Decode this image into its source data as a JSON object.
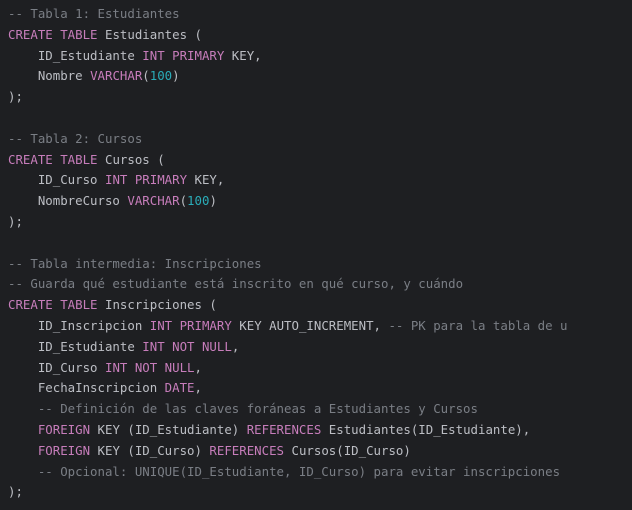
{
  "colors": {
    "background": "#1e1f22",
    "default": "#bcbec4",
    "comment": "#7a7e85",
    "keyword": "#cf8e6d",
    "type": "#c77dbb",
    "number": "#2aacb8",
    "punctuation": "#bcbec4"
  },
  "lines": [
    {
      "tokens": [
        {
          "text": "-- Tabla 1: Estudiantes",
          "kind": "comment"
        }
      ]
    },
    {
      "tokens": [
        {
          "text": "CREATE TABLE",
          "kind": "type"
        },
        {
          "text": " Estudiantes (",
          "kind": "default"
        }
      ]
    },
    {
      "tokens": [
        {
          "text": "    ID_Estudiante ",
          "kind": "default"
        },
        {
          "text": "INT PRIMARY",
          "kind": "type"
        },
        {
          "text": " KEY,",
          "kind": "default"
        }
      ]
    },
    {
      "tokens": [
        {
          "text": "    Nombre ",
          "kind": "default"
        },
        {
          "text": "VARCHAR",
          "kind": "type"
        },
        {
          "text": "(",
          "kind": "default"
        },
        {
          "text": "100",
          "kind": "number"
        },
        {
          "text": ")",
          "kind": "default"
        }
      ]
    },
    {
      "tokens": [
        {
          "text": ");",
          "kind": "default"
        }
      ]
    },
    {
      "tokens": []
    },
    {
      "tokens": [
        {
          "text": "-- Tabla 2: Cursos",
          "kind": "comment"
        }
      ]
    },
    {
      "tokens": [
        {
          "text": "CREATE TABLE",
          "kind": "type"
        },
        {
          "text": " Cursos (",
          "kind": "default"
        }
      ]
    },
    {
      "tokens": [
        {
          "text": "    ID_Curso ",
          "kind": "default"
        },
        {
          "text": "INT PRIMARY",
          "kind": "type"
        },
        {
          "text": " KEY,",
          "kind": "default"
        }
      ]
    },
    {
      "tokens": [
        {
          "text": "    NombreCurso ",
          "kind": "default"
        },
        {
          "text": "VARCHAR",
          "kind": "type"
        },
        {
          "text": "(",
          "kind": "default"
        },
        {
          "text": "100",
          "kind": "number"
        },
        {
          "text": ")",
          "kind": "default"
        }
      ]
    },
    {
      "tokens": [
        {
          "text": ");",
          "kind": "default"
        }
      ]
    },
    {
      "tokens": []
    },
    {
      "tokens": [
        {
          "text": "-- Tabla intermedia: Inscripciones",
          "kind": "comment"
        }
      ]
    },
    {
      "tokens": [
        {
          "text": "-- Guarda qué estudiante está inscrito en qué curso, y cuándo",
          "kind": "comment"
        }
      ]
    },
    {
      "tokens": [
        {
          "text": "CREATE TABLE",
          "kind": "type"
        },
        {
          "text": " Inscripciones (",
          "kind": "default"
        }
      ]
    },
    {
      "tokens": [
        {
          "text": "    ID_Inscripcion ",
          "kind": "default"
        },
        {
          "text": "INT PRIMARY",
          "kind": "type"
        },
        {
          "text": " KEY AUTO_INCREMENT, ",
          "kind": "default"
        },
        {
          "text": "-- PK para la tabla de u",
          "kind": "comment"
        }
      ]
    },
    {
      "tokens": [
        {
          "text": "    ID_Estudiante ",
          "kind": "default"
        },
        {
          "text": "INT NOT NULL",
          "kind": "type"
        },
        {
          "text": ",",
          "kind": "default"
        }
      ]
    },
    {
      "tokens": [
        {
          "text": "    ID_Curso ",
          "kind": "default"
        },
        {
          "text": "INT NOT NULL",
          "kind": "type"
        },
        {
          "text": ",",
          "kind": "default"
        }
      ]
    },
    {
      "tokens": [
        {
          "text": "    FechaInscripcion ",
          "kind": "default"
        },
        {
          "text": "DATE",
          "kind": "type"
        },
        {
          "text": ",",
          "kind": "default"
        }
      ]
    },
    {
      "tokens": [
        {
          "text": "    -- Definición de las claves foráneas a Estudiantes y Cursos",
          "kind": "comment"
        }
      ]
    },
    {
      "tokens": [
        {
          "text": "    FOREIGN",
          "kind": "type"
        },
        {
          "text": " KEY (ID_Estudiante) ",
          "kind": "default"
        },
        {
          "text": "REFERENCES",
          "kind": "type"
        },
        {
          "text": " Estudiantes(ID_Estudiante),",
          "kind": "default"
        }
      ]
    },
    {
      "tokens": [
        {
          "text": "    FOREIGN",
          "kind": "type"
        },
        {
          "text": " KEY (ID_Curso) ",
          "kind": "default"
        },
        {
          "text": "REFERENCES",
          "kind": "type"
        },
        {
          "text": " Cursos(ID_Curso)",
          "kind": "default"
        }
      ]
    },
    {
      "tokens": [
        {
          "text": "    -- Opcional: UNIQUE(ID_Estudiante, ID_Curso) para evitar inscripciones",
          "kind": "comment"
        }
      ]
    },
    {
      "tokens": [
        {
          "text": ");",
          "kind": "default"
        }
      ]
    }
  ]
}
